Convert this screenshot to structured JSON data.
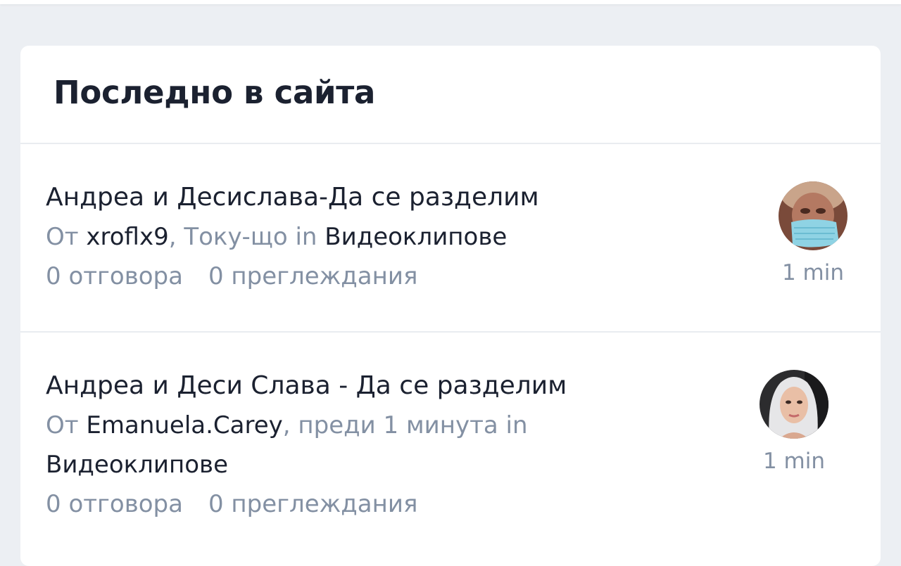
{
  "section": {
    "title": "Последно в сайта"
  },
  "topics": [
    {
      "title": "Андреа и Десислава-Да се разделим",
      "by_label": "От",
      "author": "xroflx9",
      "time_text": ", Току-що in",
      "category": "Видеоклипове",
      "replies": "0 отговора",
      "views": "0 преглеждания",
      "last_activity": "1 min",
      "avatar_icon": "user-avatar-masked"
    },
    {
      "title": "Андреа и Деси Слава - Да се разделим",
      "by_label": "От",
      "author": "Emanuela.Carey",
      "time_text": ", преди 1 минута in",
      "category": "Видеоклипове",
      "replies": "0 отговора",
      "views": "0 преглеждания",
      "last_activity": "1 min",
      "avatar_icon": "user-avatar-blonde"
    }
  ],
  "colors": {
    "background": "#eceff3",
    "card": "#ffffff",
    "text_dark": "#1b2130",
    "text_muted": "#8390a3",
    "divider": "#e9ecf0"
  }
}
